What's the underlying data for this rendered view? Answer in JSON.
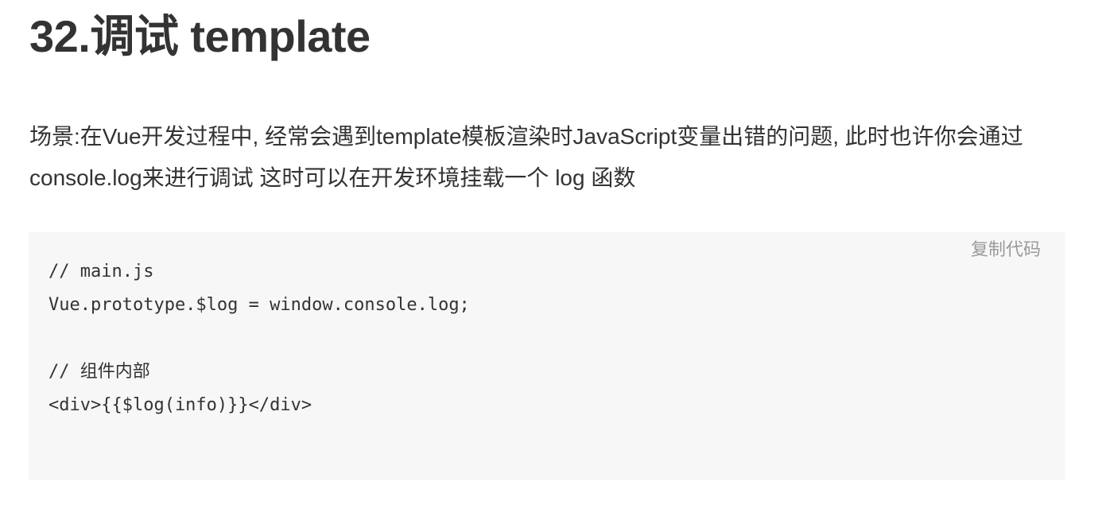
{
  "article": {
    "title": "32.调试 template",
    "description": "场景:在Vue开发过程中, 经常会遇到template模板渲染时JavaScript变量出错的问题, 此时也许你会通过console.log来进行调试 这时可以在开发环境挂载一个 log 函数"
  },
  "code_block": {
    "copy_label": "复制代码",
    "lines": [
      "// main.js",
      "Vue.prototype.$log = window.console.log;",
      "",
      "// 组件内部",
      "<div>{{$log(info)}}</div>"
    ]
  },
  "colors": {
    "text": "#333333",
    "code_background": "#f7f7f7",
    "copy_button": "#9a9a9a"
  }
}
